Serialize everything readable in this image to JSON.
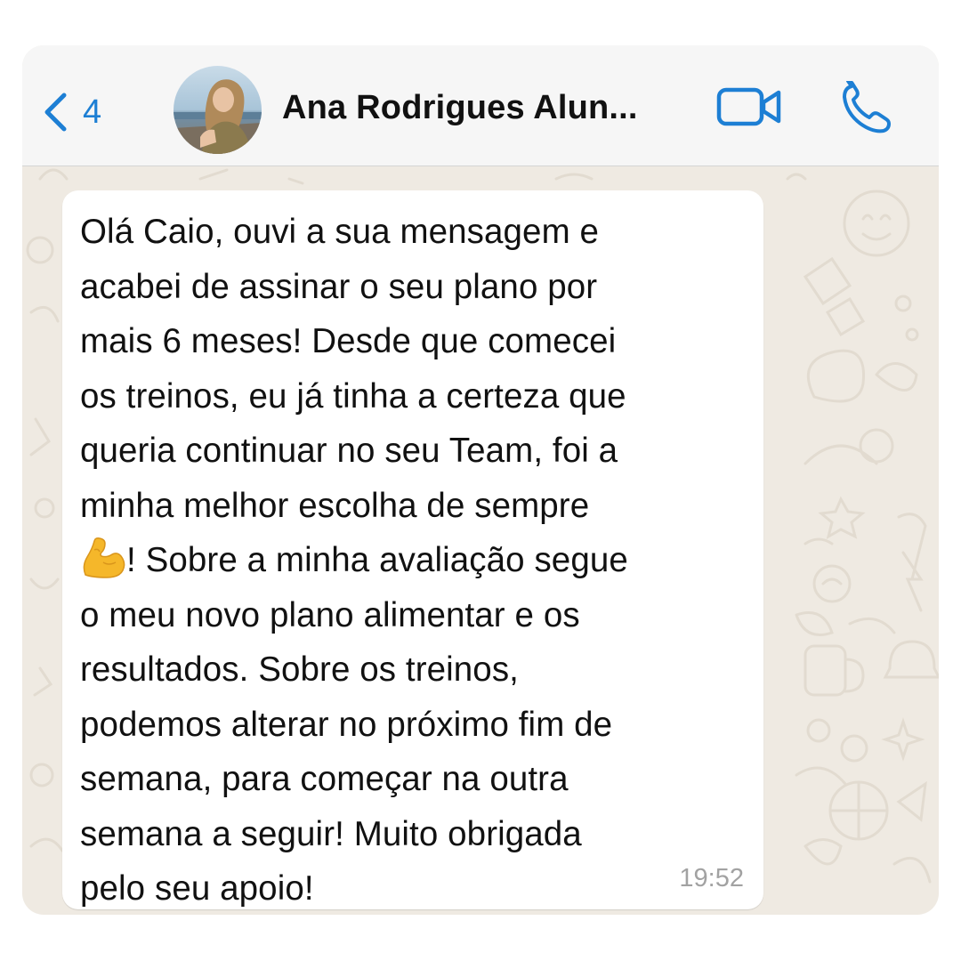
{
  "header": {
    "back_count": "4",
    "contact_name": "Ana Rodrigues Alun...",
    "video_icon": "video-camera-icon",
    "call_icon": "phone-icon",
    "accent_color": "#1d7fd4"
  },
  "message": {
    "lines": [
      "Olá Caio, ouvi a sua mensagem e",
      "acabei de assinar o seu plano por",
      "mais 6 meses! Desde que comecei",
      "os treinos, eu já tinha a certeza que",
      "queria continuar no seu Team, foi a",
      "minha melhor escolha de sempre",
      "! Sobre a minha avaliação segue",
      "o meu novo plano alimentar e os",
      "resultados. Sobre os treinos,",
      "podemos alterar no próximo fim de",
      "semana, para começar na outra",
      "semana a seguir! Muito obrigada",
      "pelo seu apoio!"
    ],
    "emoji": "flexed-biceps-emoji",
    "time": "19:52"
  }
}
